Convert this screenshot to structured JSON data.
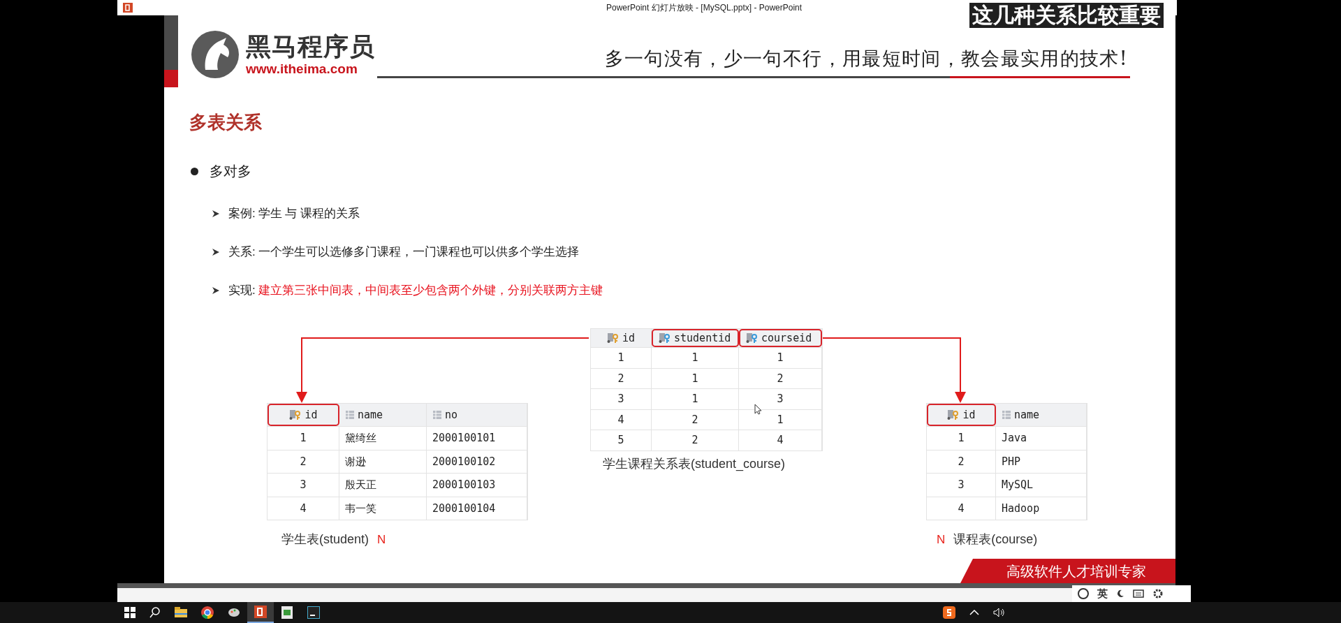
{
  "window": {
    "title": "PowerPoint 幻灯片放映 - [MySQL.pptx] - PowerPoint"
  },
  "caption": "这几种关系比较重要",
  "slide": {
    "logo": {
      "name": "黑马程序员",
      "url": "www.itheima.com"
    },
    "slogan": "多一句没有，少一句不行，用最短时间，教会最实用的技术!",
    "heading": "多表关系",
    "bullet": "多对多",
    "items": [
      {
        "label": "案例:",
        "text": "学生 与 课程的关系",
        "emphasis": false
      },
      {
        "label": "关系:",
        "text": "一个学生可以选修多门课程，一门课程也可以供多个学生选择",
        "emphasis": false
      },
      {
        "label": "实现:",
        "text": "建立第三张中间表，中间表至少包含两个外键，分别关联两方主键",
        "emphasis": true
      }
    ],
    "tables": [
      {
        "caption_parts": [
          {
            "kind": "title",
            "text": "学生表(student)"
          },
          {
            "kind": "multiplicity",
            "text": "N"
          }
        ],
        "columns": [
          {
            "label": "id",
            "kind": "key",
            "highlighted": true
          },
          {
            "label": "name",
            "kind": "column",
            "highlighted": false
          },
          {
            "label": "no",
            "kind": "column",
            "highlighted": false
          }
        ],
        "rows": [
          [
            "1",
            "黛绮丝",
            "2000100101"
          ],
          [
            "2",
            "谢逊",
            "2000100102"
          ],
          [
            "3",
            "殷天正",
            "2000100103"
          ],
          [
            "4",
            "韦一笑",
            "2000100104"
          ]
        ]
      },
      {
        "caption_parts": [
          {
            "kind": "title",
            "text": "学生课程关系表(student_course)"
          }
        ],
        "columns": [
          {
            "label": "id",
            "kind": "key",
            "highlighted": false
          },
          {
            "label": "studentid",
            "kind": "foreign",
            "highlighted": true
          },
          {
            "label": "courseid",
            "kind": "foreign",
            "highlighted": true
          }
        ],
        "rows": [
          [
            "1",
            "1",
            "1"
          ],
          [
            "2",
            "1",
            "2"
          ],
          [
            "3",
            "1",
            "3"
          ],
          [
            "4",
            "2",
            "1"
          ],
          [
            "5",
            "2",
            "4"
          ]
        ]
      },
      {
        "caption_parts": [
          {
            "kind": "multiplicity",
            "text": "N"
          },
          {
            "kind": "title",
            "text": "课程表(course)"
          }
        ],
        "columns": [
          {
            "label": "id",
            "kind": "key",
            "highlighted": true
          },
          {
            "label": "name",
            "kind": "column",
            "highlighted": false
          }
        ],
        "rows": [
          [
            "1",
            "Java"
          ],
          [
            "2",
            "PHP"
          ],
          [
            "3",
            "MySQL"
          ],
          [
            "4",
            "Hadoop"
          ]
        ]
      }
    ],
    "footer_banner": "高级软件人才培训专家"
  },
  "ime_toolbar": {
    "mode": "英"
  },
  "taskbar": {
    "apps": [
      {
        "kind": "explorer",
        "selected": false
      },
      {
        "kind": "chrome",
        "selected": false
      },
      {
        "kind": "brush",
        "selected": false
      },
      {
        "kind": "powerpoint",
        "selected": true
      },
      {
        "kind": "sheet",
        "selected": false
      },
      {
        "kind": "ide",
        "selected": false
      }
    ]
  }
}
